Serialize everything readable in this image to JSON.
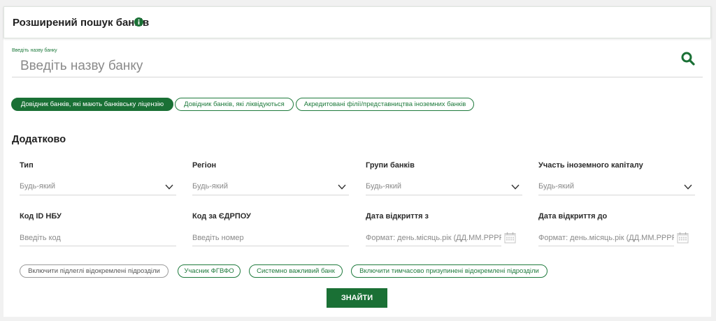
{
  "header": {
    "title": "Розширений пошук банків"
  },
  "search": {
    "label": "Введіть назву банку",
    "placeholder": "Введіть назву банку",
    "value": ""
  },
  "tabs": [
    {
      "label": "Довідник банків, які мають банківську ліцензію",
      "active": true
    },
    {
      "label": "Довідник банків, які ліквідуються",
      "active": false
    },
    {
      "label": "Акредитовані філії/представництва іноземних банків",
      "active": false
    }
  ],
  "section": {
    "title": "Додатково"
  },
  "filters": {
    "type": {
      "label": "Тип",
      "value": "Будь-який"
    },
    "region": {
      "label": "Регіон",
      "value": "Будь-який"
    },
    "bank_groups": {
      "label": "Групи банків",
      "value": "Будь-який"
    },
    "foreign_capital": {
      "label": "Участь іноземного капіталу",
      "value": "Будь-який"
    },
    "nbu_id": {
      "label": "Код ID НБУ",
      "placeholder": "Введіть код"
    },
    "edrpou": {
      "label": "Код за ЄДРПОУ",
      "placeholder": "Введіть номер"
    },
    "date_from": {
      "label": "Дата відкриття з",
      "placeholder": "Формат: день.місяць.рік (ДД.ММ.РРРР)"
    },
    "date_to": {
      "label": "Дата відкриття до",
      "placeholder": "Формат: день.місяць.рік (ДД.ММ.РРРР)"
    }
  },
  "tags": [
    {
      "label": "Включити підлеглі відокремлені підрозділи",
      "style": "grey"
    },
    {
      "label": "Учасник ФГВФО",
      "style": "green"
    },
    {
      "label": "Системно важливий банк",
      "style": "green"
    },
    {
      "label": "Включити тимчасово призупинені відокремлені підрозділи",
      "style": "green"
    }
  ],
  "submit": {
    "label": "ЗНАЙТИ"
  },
  "colors": {
    "accent": "#1a7035",
    "background": "#f1f1f1"
  }
}
